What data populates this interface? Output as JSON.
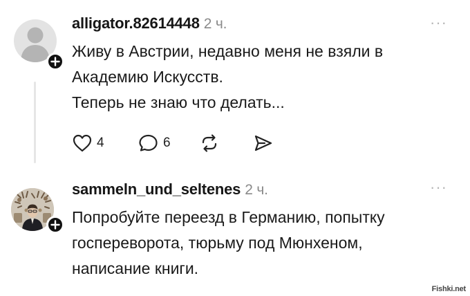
{
  "comments": [
    {
      "username": "alligator.82614448",
      "time": "2 ч.",
      "lines": [
        "Живу в Австрии, недавно меня не взяли в",
        "Академию Искусств.",
        "Теперь не знаю что делать..."
      ],
      "likes": "4",
      "replies": "6"
    },
    {
      "username": "sammeln_und_seltenes",
      "time": "2 ч.",
      "lines": [
        "Попробуйте переезд в Германию, попытку",
        "госпереворота, тюрьму под Мюнхеном,",
        "написание книги."
      ]
    }
  ],
  "more_glyph": "···",
  "watermark": "Fishki.net",
  "icons": [
    "user-placeholder-icon",
    "plus-icon",
    "heart-icon",
    "comment-icon",
    "repost-icon",
    "share-icon",
    "more-icon"
  ]
}
